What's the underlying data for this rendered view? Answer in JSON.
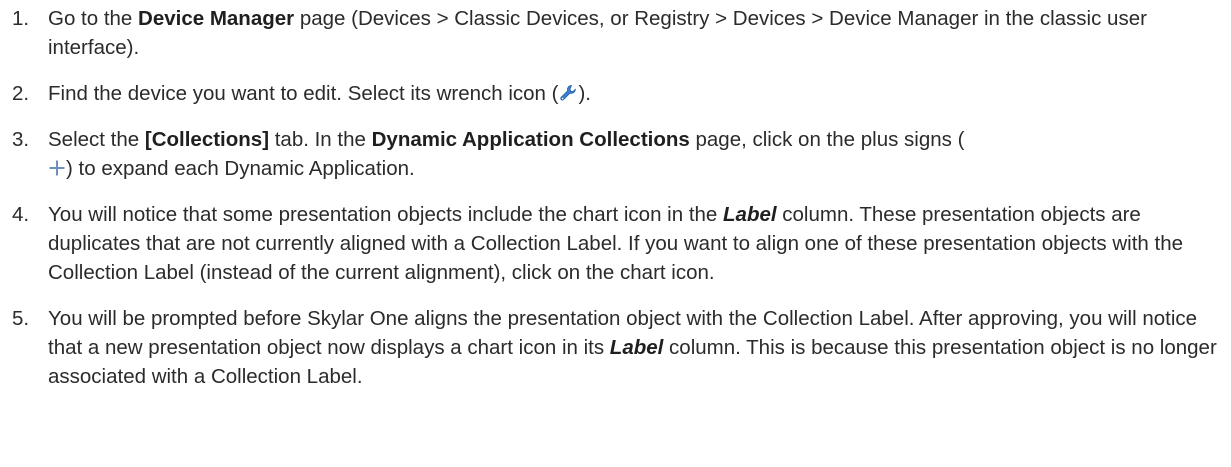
{
  "steps": [
    {
      "number": "1.",
      "text_a": "Go to the ",
      "bold_a": "Device Manager",
      "text_b": " page (Devices > Classic Devices, or Registry > Devices > Device Manager in the classic user interface)."
    },
    {
      "number": "2.",
      "text_a": "Find the device you want to edit. Select its wrench icon (",
      "text_b": ")."
    },
    {
      "number": "3.",
      "text_a": "Select the ",
      "bold_a": "[Collections]",
      "text_b": " tab. In the ",
      "bold_b": "Dynamic Application Collections",
      "text_c": " page, click on the plus signs (",
      "text_d": ") to expand each Dynamic Application."
    },
    {
      "number": "4.",
      "text_a": "You will notice that some presentation objects include the chart icon in the ",
      "bold_italic_a": "Label",
      "text_b": " column. These presentation objects are duplicates that are not currently aligned with a Collection Label. If you want to align one of these presentation objects with the Collection Label (instead of the current alignment), click on the chart icon."
    },
    {
      "number": "5.",
      "text_a": "You will be prompted before Skylar One aligns the presentation object with the Collection Label. After approving, you will notice that a new presentation object now displays a chart icon in its ",
      "bold_italic_a": "Label",
      "text_b": " column. This is because this presentation object is no longer associated with a Collection Label."
    }
  ],
  "icons": {
    "wrench": "wrench-icon",
    "plus": "plus-icon"
  },
  "colors": {
    "text": "#2b2b2b",
    "wrench": "#3a7fd0",
    "plus": "#6f8fbf"
  }
}
